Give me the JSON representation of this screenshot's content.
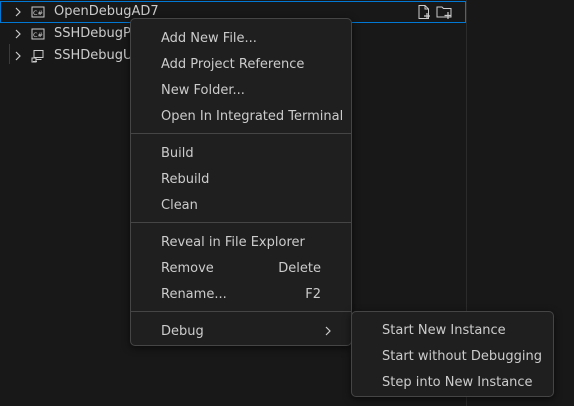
{
  "explorer": {
    "items": [
      {
        "label": "OpenDebugAD7",
        "icon": "csharp-project-icon",
        "selected": true
      },
      {
        "label": "SSHDebugPS",
        "icon": "csharp-project-icon",
        "selected": false
      },
      {
        "label": "SSHDebugUn",
        "icon": "test-project-icon",
        "selected": false
      }
    ],
    "row_actions": [
      "new-file-icon",
      "new-folder-icon"
    ]
  },
  "context_menu": {
    "groups": [
      [
        {
          "label": "Add New File..."
        },
        {
          "label": "Add Project Reference"
        },
        {
          "label": "New Folder..."
        },
        {
          "label": "Open In Integrated Terminal"
        }
      ],
      [
        {
          "label": "Build"
        },
        {
          "label": "Rebuild"
        },
        {
          "label": "Clean"
        }
      ],
      [
        {
          "label": "Reveal in File Explorer"
        },
        {
          "label": "Remove",
          "shortcut": "Delete"
        },
        {
          "label": "Rename...",
          "shortcut": "F2"
        }
      ],
      [
        {
          "label": "Debug",
          "has_submenu": true
        }
      ]
    ]
  },
  "debug_submenu": {
    "items": [
      {
        "label": "Start New Instance"
      },
      {
        "label": "Start without Debugging"
      },
      {
        "label": "Step into New Instance"
      }
    ]
  },
  "colors": {
    "background": "#181818",
    "menu_background": "#1f1f1f",
    "menu_border": "#454545",
    "selection_outline": "#0078d4",
    "text": "#cccccc"
  }
}
